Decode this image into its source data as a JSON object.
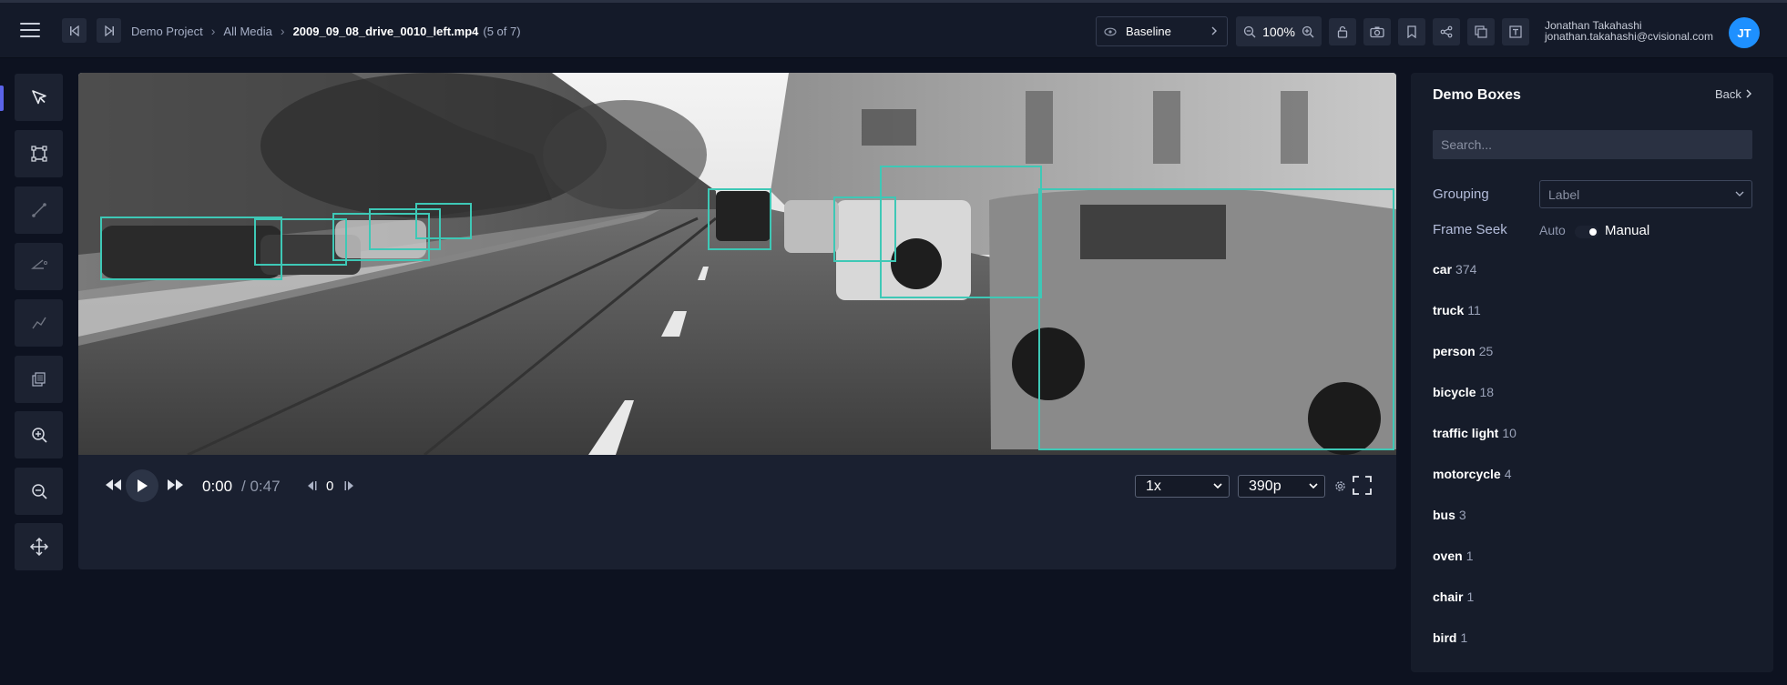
{
  "header": {
    "breadcrumb": {
      "project": "Demo Project",
      "media": "All Media",
      "file": "2009_09_08_drive_0010_left.mp4",
      "position": "(5 of 7)"
    },
    "baseline_label": "Baseline",
    "zoom_level": "100%",
    "user": {
      "name": "Jonathan Takahashi",
      "email": "jonathan.takahashi@cvisional.com",
      "initials": "JT"
    }
  },
  "toolbar": {
    "tools": [
      "select-tool-icon",
      "box-tool-icon",
      "line-tool-icon",
      "angle-tool-icon",
      "polyline-tool-icon",
      "copy-tool-icon",
      "zoom-in-icon",
      "zoom-out-icon",
      "pan-tool-icon"
    ]
  },
  "player": {
    "time_current": "0:00",
    "time_total": "/ 0:47",
    "frame": "0",
    "speed": "1x",
    "quality": "390p",
    "timeline_progress": 0.3,
    "timeline_ticks": [
      "200",
      "400",
      "600",
      "800",
      "1000",
      "1200",
      "1400"
    ]
  },
  "sidebar": {
    "title": "Demo Boxes",
    "back_label": "Back",
    "search_placeholder": "Search...",
    "grouping_label": "Grouping",
    "grouping_value": "Label",
    "frame_seek_label": "Frame Seek",
    "frame_seek_auto": "Auto",
    "frame_seek_manual": "Manual",
    "labels": [
      {
        "name": "car",
        "count": "374"
      },
      {
        "name": "truck",
        "count": "11"
      },
      {
        "name": "person",
        "count": "25"
      },
      {
        "name": "bicycle",
        "count": "18"
      },
      {
        "name": "traffic light",
        "count": "10"
      },
      {
        "name": "motorcycle",
        "count": "4"
      },
      {
        "name": "bus",
        "count": "3"
      },
      {
        "name": "oven",
        "count": "1"
      },
      {
        "name": "chair",
        "count": "1"
      },
      {
        "name": "bird",
        "count": "1"
      }
    ]
  },
  "colors": {
    "accent": "#5a63e8",
    "bbox": "#3ec8b6",
    "avatar": "#1e90ff"
  }
}
